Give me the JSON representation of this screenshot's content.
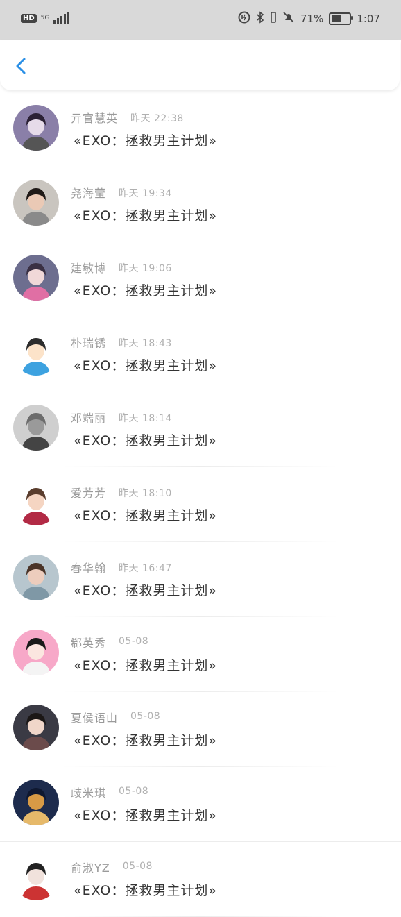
{
  "status_bar": {
    "hd": "HD",
    "network": "5G",
    "signal_level": 4,
    "battery_text": "71%",
    "battery_level": 0.71,
    "time": "1:07",
    "icons": [
      "hd-icon",
      "signal-icon",
      "data-saver-icon",
      "bluetooth-icon",
      "vibrate-icon",
      "mute-icon",
      "battery-icon"
    ]
  },
  "header": {
    "back_icon": "back-chevron-icon"
  },
  "comments": [
    {
      "name": "亓官慧英",
      "time": "昨天 22:38",
      "book": "«EXO：拯救男主计划»"
    },
    {
      "name": "尧海莹",
      "time": "昨天 19:34",
      "book": "«EXO：拯救男主计划»"
    },
    {
      "name": "建敏博",
      "time": "昨天 19:06",
      "book": "«EXO：拯救男主计划»"
    },
    {
      "name": "朴瑞锈",
      "time": "昨天 18:43",
      "book": "«EXO：拯救男主计划»"
    },
    {
      "name": "邓端丽",
      "time": "昨天 18:14",
      "book": "«EXO：拯救男主计划»"
    },
    {
      "name": "爱芳芳",
      "time": "昨天 18:10",
      "book": "«EXO：拯救男主计划»"
    },
    {
      "name": "春华翰",
      "time": "昨天 16:47",
      "book": "«EXO：拯救男主计划»"
    },
    {
      "name": "郗英秀",
      "time": "05-08",
      "book": "«EXO：拯救男主计划»"
    },
    {
      "name": "夏侯语山",
      "time": "05-08",
      "book": "«EXO：拯救男主计划»"
    },
    {
      "name": "歧米琪",
      "time": "05-08",
      "book": "«EXO：拯救男主计划»"
    },
    {
      "name": "俞淑YZ",
      "time": "05-08",
      "book": "«EXO：拯救男主计划»"
    }
  ],
  "colors": {
    "accent": "#2a8fe6",
    "status_bar": "#d9d9d9",
    "name_text": "#9a9a9a",
    "title_text": "#333333"
  }
}
